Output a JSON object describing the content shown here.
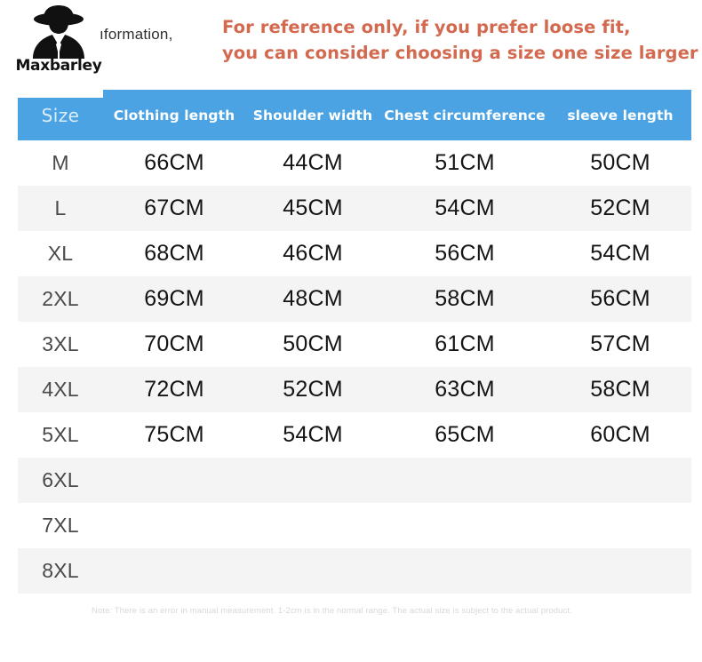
{
  "brand": {
    "name": "Maxbarley",
    "logo_icon": "person-in-wide-brim-hat-icon"
  },
  "header": {
    "section_caption": "ıformation,",
    "notice_line1": "For reference only, if you prefer loose fit,",
    "notice_line2": "you can consider choosing a size one size larger",
    "notice_color": "#d3694f"
  },
  "table": {
    "header_bg": "#4ba3e3",
    "row_bg": "#ffffff",
    "row_alt_bg": "#f4f4f4",
    "columns": [
      "Size",
      "Clothing length",
      "Shoulder width",
      "Chest circumference",
      "sleeve length"
    ],
    "rows": [
      {
        "size": "M",
        "clothing_length": "66CM",
        "shoulder_width": "44CM",
        "chest_circumference": "51CM",
        "sleeve_length": "50CM"
      },
      {
        "size": "L",
        "clothing_length": "67CM",
        "shoulder_width": "45CM",
        "chest_circumference": "54CM",
        "sleeve_length": "52CM"
      },
      {
        "size": "XL",
        "clothing_length": "68CM",
        "shoulder_width": "46CM",
        "chest_circumference": "56CM",
        "sleeve_length": "54CM"
      },
      {
        "size": "2XL",
        "clothing_length": "69CM",
        "shoulder_width": "48CM",
        "chest_circumference": "58CM",
        "sleeve_length": "56CM"
      },
      {
        "size": "3XL",
        "clothing_length": "70CM",
        "shoulder_width": "50CM",
        "chest_circumference": "61CM",
        "sleeve_length": "57CM"
      },
      {
        "size": "4XL",
        "clothing_length": "72CM",
        "shoulder_width": "52CM",
        "chest_circumference": "63CM",
        "sleeve_length": "58CM"
      },
      {
        "size": "5XL",
        "clothing_length": "75CM",
        "shoulder_width": "54CM",
        "chest_circumference": "65CM",
        "sleeve_length": "60CM"
      },
      {
        "size": "6XL",
        "clothing_length": "",
        "shoulder_width": "",
        "chest_circumference": "",
        "sleeve_length": ""
      },
      {
        "size": "7XL",
        "clothing_length": "",
        "shoulder_width": "",
        "chest_circumference": "",
        "sleeve_length": ""
      },
      {
        "size": "8XL",
        "clothing_length": "",
        "shoulder_width": "",
        "chest_circumference": "",
        "sleeve_length": ""
      }
    ]
  },
  "footer": {
    "note": "Note: There is an error in manual measurement. 1-2cm is in the normal range. The actual size is subject to the actual product."
  }
}
